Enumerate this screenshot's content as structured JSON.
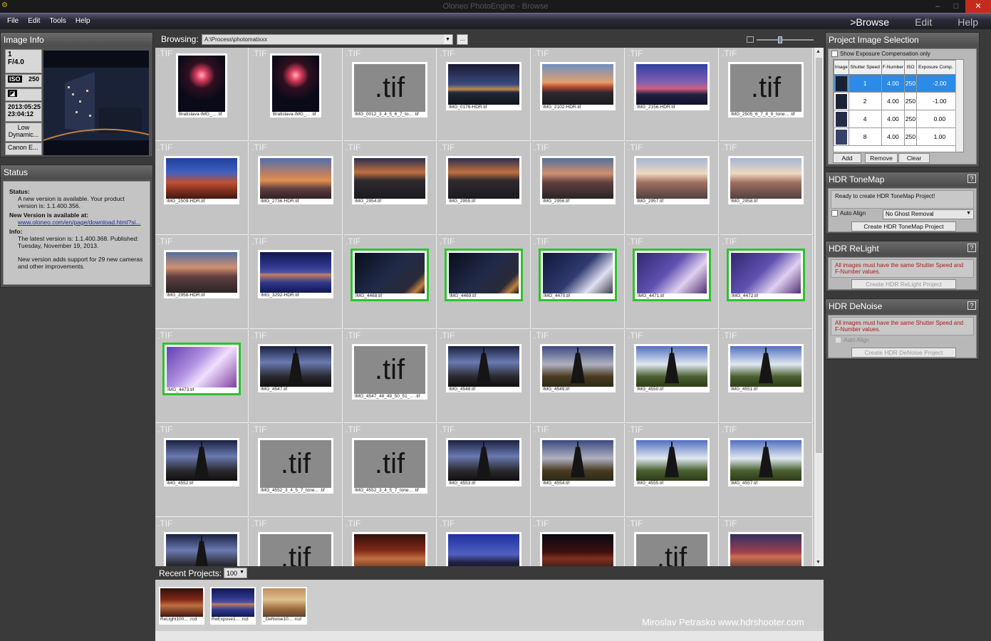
{
  "window": {
    "title": "Oloneo PhotoEngine - Browse"
  },
  "menu": [
    "File",
    "Edit",
    "Tools",
    "Help"
  ],
  "modes": [
    {
      "label": ">Browse",
      "active": true
    },
    {
      "label": "Edit",
      "active": false
    },
    {
      "label": "Help",
      "active": false
    }
  ],
  "image_info": {
    "title": "Image Info",
    "shutter": "1",
    "aperture": "F/4.0",
    "iso_label": "ISO",
    "iso": "250",
    "date": "2013:05:25",
    "time": "23:04:12",
    "lens": "Low Dynamic...",
    "camera": "Canon E..."
  },
  "status": {
    "title": "Status",
    "status_label": "Status:",
    "status_text": "A new version is available. Your product version is: 1.1.400.356.",
    "new_version_label": "New Version is available at:",
    "link": "www.oloneo.com/en/page/download.html?si...",
    "info_label": "Info:",
    "info_text1": "The latest version is: 1.1.400.368. Published: Tuesday, November 19, 2013.",
    "info_text2": "New version adds support for 29 new cameras and other improvements."
  },
  "browse": {
    "label": "Browsing:",
    "path": "A:\\Process\\photomatixxx",
    "dots": "..."
  },
  "thumbs": [
    {
      "cap": "Bratislava-IMG_... .tif",
      "kind": "fw",
      "portrait": true
    },
    {
      "cap": "Bratislava-IMG_... .tif",
      "kind": "fw",
      "portrait": true
    },
    {
      "cap": "IMG_0012_3_4_5_6_7_to... .tif",
      "kind": "tif"
    },
    {
      "cap": "IMG_0176-HDR.tif",
      "kind": "bridge"
    },
    {
      "cap": "IMG_2102-HDR.tif",
      "kind": "sunset"
    },
    {
      "cap": "IMG_2156-HDR.tif",
      "kind": "dusk"
    },
    {
      "cap": "IMG_2505_6_7_8_9_tone... .tif",
      "kind": "tif"
    },
    {
      "cap": "IMG_2509-HDR.tif",
      "kind": "market"
    },
    {
      "cap": "IMG_2736-HDR.tif",
      "kind": "castle"
    },
    {
      "cap": "IMG_2954.tif",
      "kind": "city"
    },
    {
      "cap": "IMG_2955.tif",
      "kind": "city"
    },
    {
      "cap": "IMG_2956.tif",
      "kind": "city2"
    },
    {
      "cap": "IMG_2957.tif",
      "kind": "city3"
    },
    {
      "cap": "IMG_2958.tif",
      "kind": "city3"
    },
    {
      "cap": "IMG_2958-HDR.tif",
      "kind": "city2"
    },
    {
      "cap": "IMG_3292-HDR.tif",
      "kind": "reflect"
    },
    {
      "cap": "IMG_4468.tif",
      "kind": "bldg",
      "sel": true
    },
    {
      "cap": "IMG_4469.tif",
      "kind": "bldg",
      "sel": true
    },
    {
      "cap": "IMG_4470.tif",
      "kind": "bldg2",
      "sel": true
    },
    {
      "cap": "IMG_4471.tif",
      "kind": "bldg3",
      "sel": true
    },
    {
      "cap": "IMG_4472.tif",
      "kind": "bldg3",
      "sel": true
    },
    {
      "cap": "IMG_4473.tif",
      "kind": "bldg4",
      "sel": true
    },
    {
      "cap": "IMG_4547.tif",
      "kind": "eiffel"
    },
    {
      "cap": "IMG_4547_48_49_50_51_... .tif",
      "kind": "tif"
    },
    {
      "cap": "IMG_4548.tif",
      "kind": "eiffel"
    },
    {
      "cap": "IMG_4549.tif",
      "kind": "eiffel2"
    },
    {
      "cap": "IMG_4550.tif",
      "kind": "eiffel3"
    },
    {
      "cap": "IMG_4551.tif",
      "kind": "eiffel3"
    },
    {
      "cap": "IMG_4552.tif",
      "kind": "eiffel"
    },
    {
      "cap": "IMG_4552_3_4_5_7_tone... .tif",
      "kind": "tif"
    },
    {
      "cap": "IMG_4552_3_4_5_7_tone... .tif",
      "kind": "tif"
    },
    {
      "cap": "IMG_4553.tif",
      "kind": "eiffel"
    },
    {
      "cap": "IMG_4554.tif",
      "kind": "eiffel2"
    },
    {
      "cap": "IMG_4555.tif",
      "kind": "eiffel3"
    },
    {
      "cap": "IMG_4557.tif",
      "kind": "eiffel3"
    },
    {
      "cap": "",
      "kind": "eiffel"
    },
    {
      "cap": "",
      "kind": "tif"
    },
    {
      "cap": "",
      "kind": "interior"
    },
    {
      "cap": "",
      "kind": "bigben"
    },
    {
      "cap": "",
      "kind": "redsky"
    },
    {
      "cap": "",
      "kind": "tif"
    },
    {
      "cap": "",
      "kind": "redsky2"
    }
  ],
  "ext_label": ".TIF",
  "recent": {
    "label": "Recent Projects:",
    "count": "100",
    "items": [
      {
        "cap": "ReLight100... .rcd",
        "kind": "interior"
      },
      {
        "cap": "ReExpose1... .rcd",
        "kind": "reflect"
      },
      {
        "cap": "_DeNoise10... .rcd",
        "kind": "lamp"
      }
    ],
    "watermark": "Miroslav  Petrasko  www.hdrshooter.com"
  },
  "project": {
    "title": "Project Image Selection",
    "checkbox": "Show Exposure Compensation only",
    "headers": [
      "Image",
      "Shutter Speed",
      "F-Number",
      "ISO",
      "Exposure Comp."
    ],
    "rows": [
      [
        "1",
        "4.00",
        "250",
        "-2.00"
      ],
      [
        "2",
        "4.00",
        "250",
        "-1.00"
      ],
      [
        "4",
        "4.00",
        "250",
        "0.00"
      ],
      [
        "8",
        "4.00",
        "250",
        "1.00"
      ]
    ],
    "add": "Add",
    "remove": "Remove",
    "clear": "Clear"
  },
  "tonemap": {
    "title": "HDR ToneMap",
    "msg": "Ready to create HDR ToneMap Project!",
    "auto_align": "Auto Align",
    "ghost": "No Ghost Removal",
    "create": "Create HDR ToneMap Project"
  },
  "relight": {
    "title": "HDR ReLight",
    "msg": "All images must have the same Shutter Speed and F-Number values.",
    "create": "Create HDR ReLight Project"
  },
  "denoise": {
    "title": "HDR DeNoise",
    "msg": "All images must have the same Shutter Speed and F-Number values.",
    "auto_align": "Auto Align",
    "create": "Create HDR DeNoise Project"
  },
  "help_q": "?",
  "tif_text": ".tif",
  "colors": {
    "selection": "#2dc22d",
    "accent": "#2b8be6"
  }
}
